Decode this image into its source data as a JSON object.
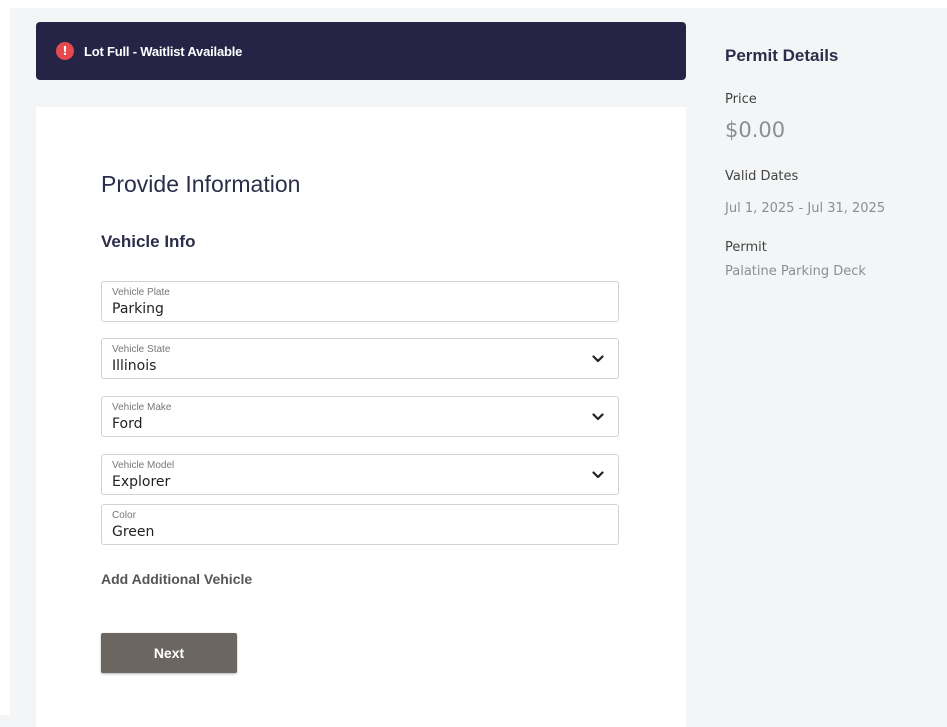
{
  "alert": {
    "icon": "exclamation-icon",
    "icon_glyph": "!",
    "text": "Lot Full - Waitlist Available",
    "color": "#252446"
  },
  "form": {
    "title": "Provide Information",
    "section_title": "Vehicle Info",
    "fields": [
      {
        "label": "Vehicle Plate",
        "value": "Parking",
        "type": "text"
      },
      {
        "label": "Vehicle State",
        "value": "Illinois",
        "type": "select"
      },
      {
        "label": "Vehicle Make",
        "value": "Ford",
        "type": "select"
      },
      {
        "label": "Vehicle Model",
        "value": "Explorer",
        "type": "select"
      },
      {
        "label": "Color",
        "value": "Green",
        "type": "text"
      }
    ],
    "add_vehicle_label": "Add Additional Vehicle",
    "next_label": "Next",
    "next_button_color": "#6b6660"
  },
  "permit": {
    "title": "Permit Details",
    "price_label": "Price",
    "price_value": "$0.00",
    "dates_label": "Valid Dates",
    "dates_value": "Jul 1, 2025 - Jul 31, 2025",
    "permit_label": "Permit",
    "permit_value": "Palatine Parking Deck"
  }
}
